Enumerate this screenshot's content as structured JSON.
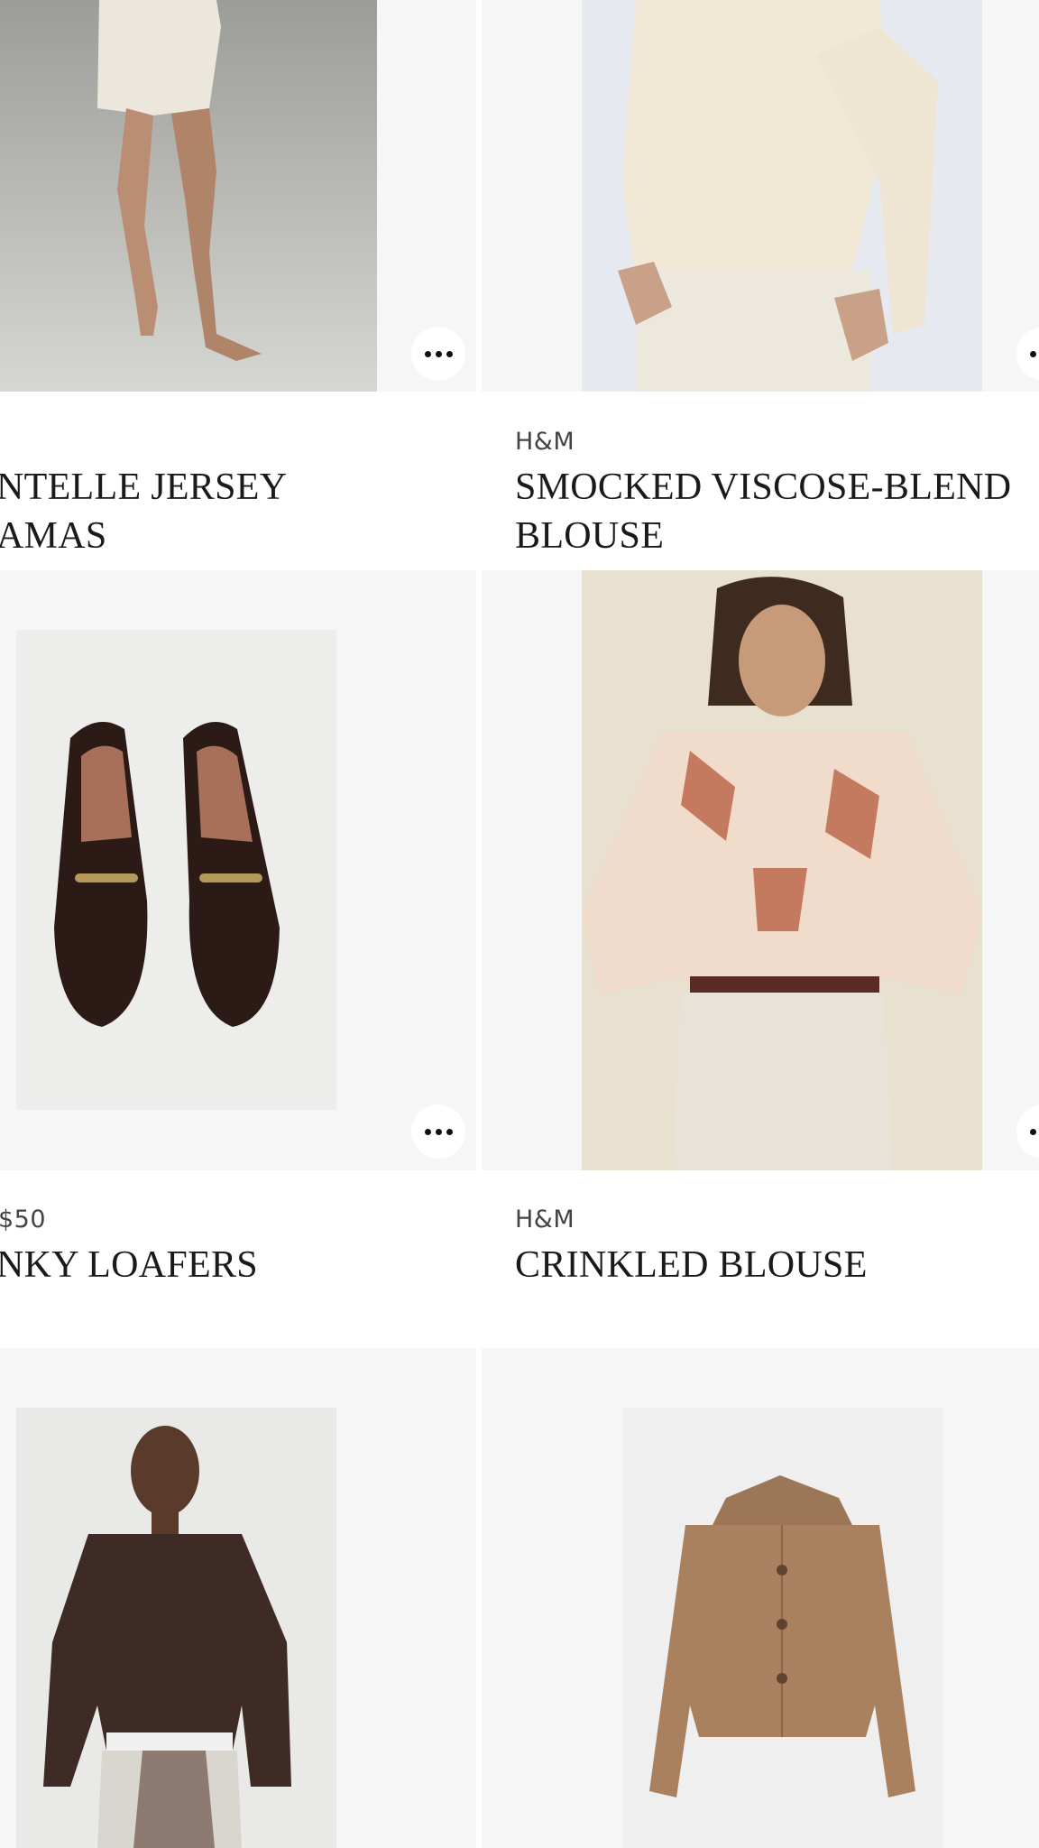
{
  "products": [
    {
      "brand": "",
      "title": "NTELLE JERSEY\nAMAS",
      "image": "woman-in-pajama-shorts-photo"
    },
    {
      "brand": "H&M",
      "title": "SMOCKED VISCOSE-BLEND\nBLOUSE",
      "image": "smocked-blouse-photo"
    },
    {
      "brand": "$50",
      "title": "NKY LOAFERS",
      "image": "loafers-photo"
    },
    {
      "brand": "H&M",
      "title": "CRINKLED BLOUSE",
      "image": "paisley-blouse-photo"
    },
    {
      "brand": "",
      "title": "",
      "image": "brown-sweater-model-photo"
    },
    {
      "brand": "",
      "title": "",
      "image": "tan-jacket-photo"
    }
  ],
  "actions": {
    "more_icon": "more-options-icon"
  },
  "colors": {
    "tile_background": "#f6f6f6",
    "text": "#1a1a1a",
    "brand_text": "#444444"
  }
}
